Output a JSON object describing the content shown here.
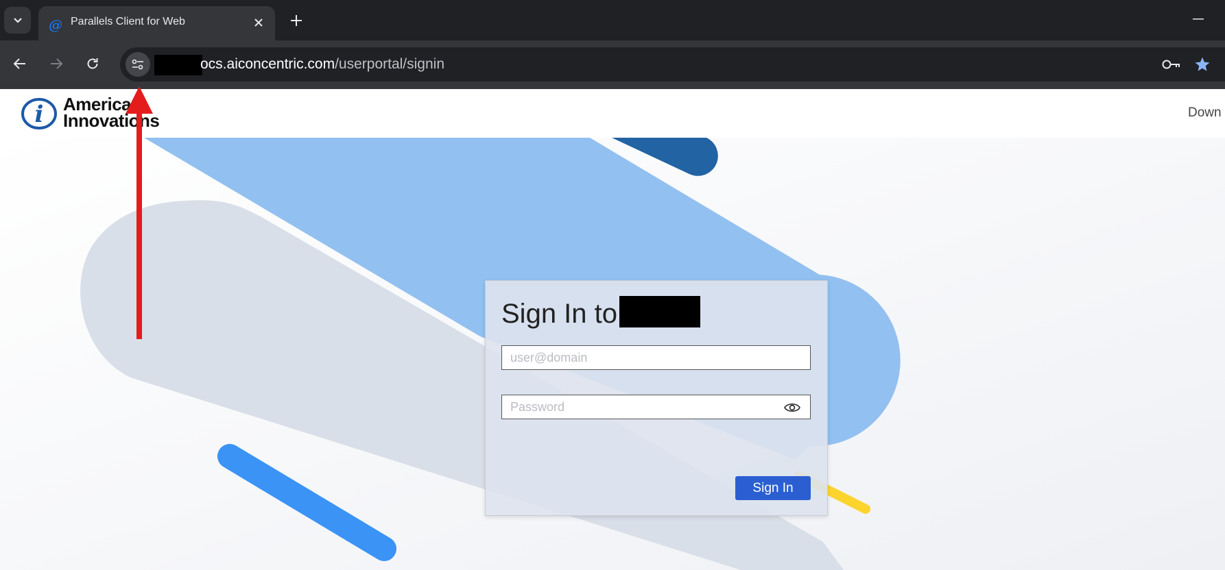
{
  "browser": {
    "tab_title": "Parallels Client for Web",
    "url_host": "ocs.aiconcentric.com",
    "url_path": "/userportal/signin"
  },
  "page": {
    "logo_line1": "American",
    "logo_line2": "Innovations",
    "nav_download": "Down",
    "signin": {
      "title_prefix": "Sign In to",
      "username_placeholder": "user@domain",
      "password_placeholder": "Password",
      "button_label": "Sign In"
    }
  },
  "colors": {
    "accent_button": "#2b5fd1",
    "shape_light_blue": "#92c0f0",
    "shape_dark_blue": "#2263a3",
    "shape_gray": "#d9dfe8",
    "shape_bright_blue": "#3a93f5",
    "shape_yellow": "#fcd42d",
    "annotation_arrow": "#e41c1c"
  }
}
